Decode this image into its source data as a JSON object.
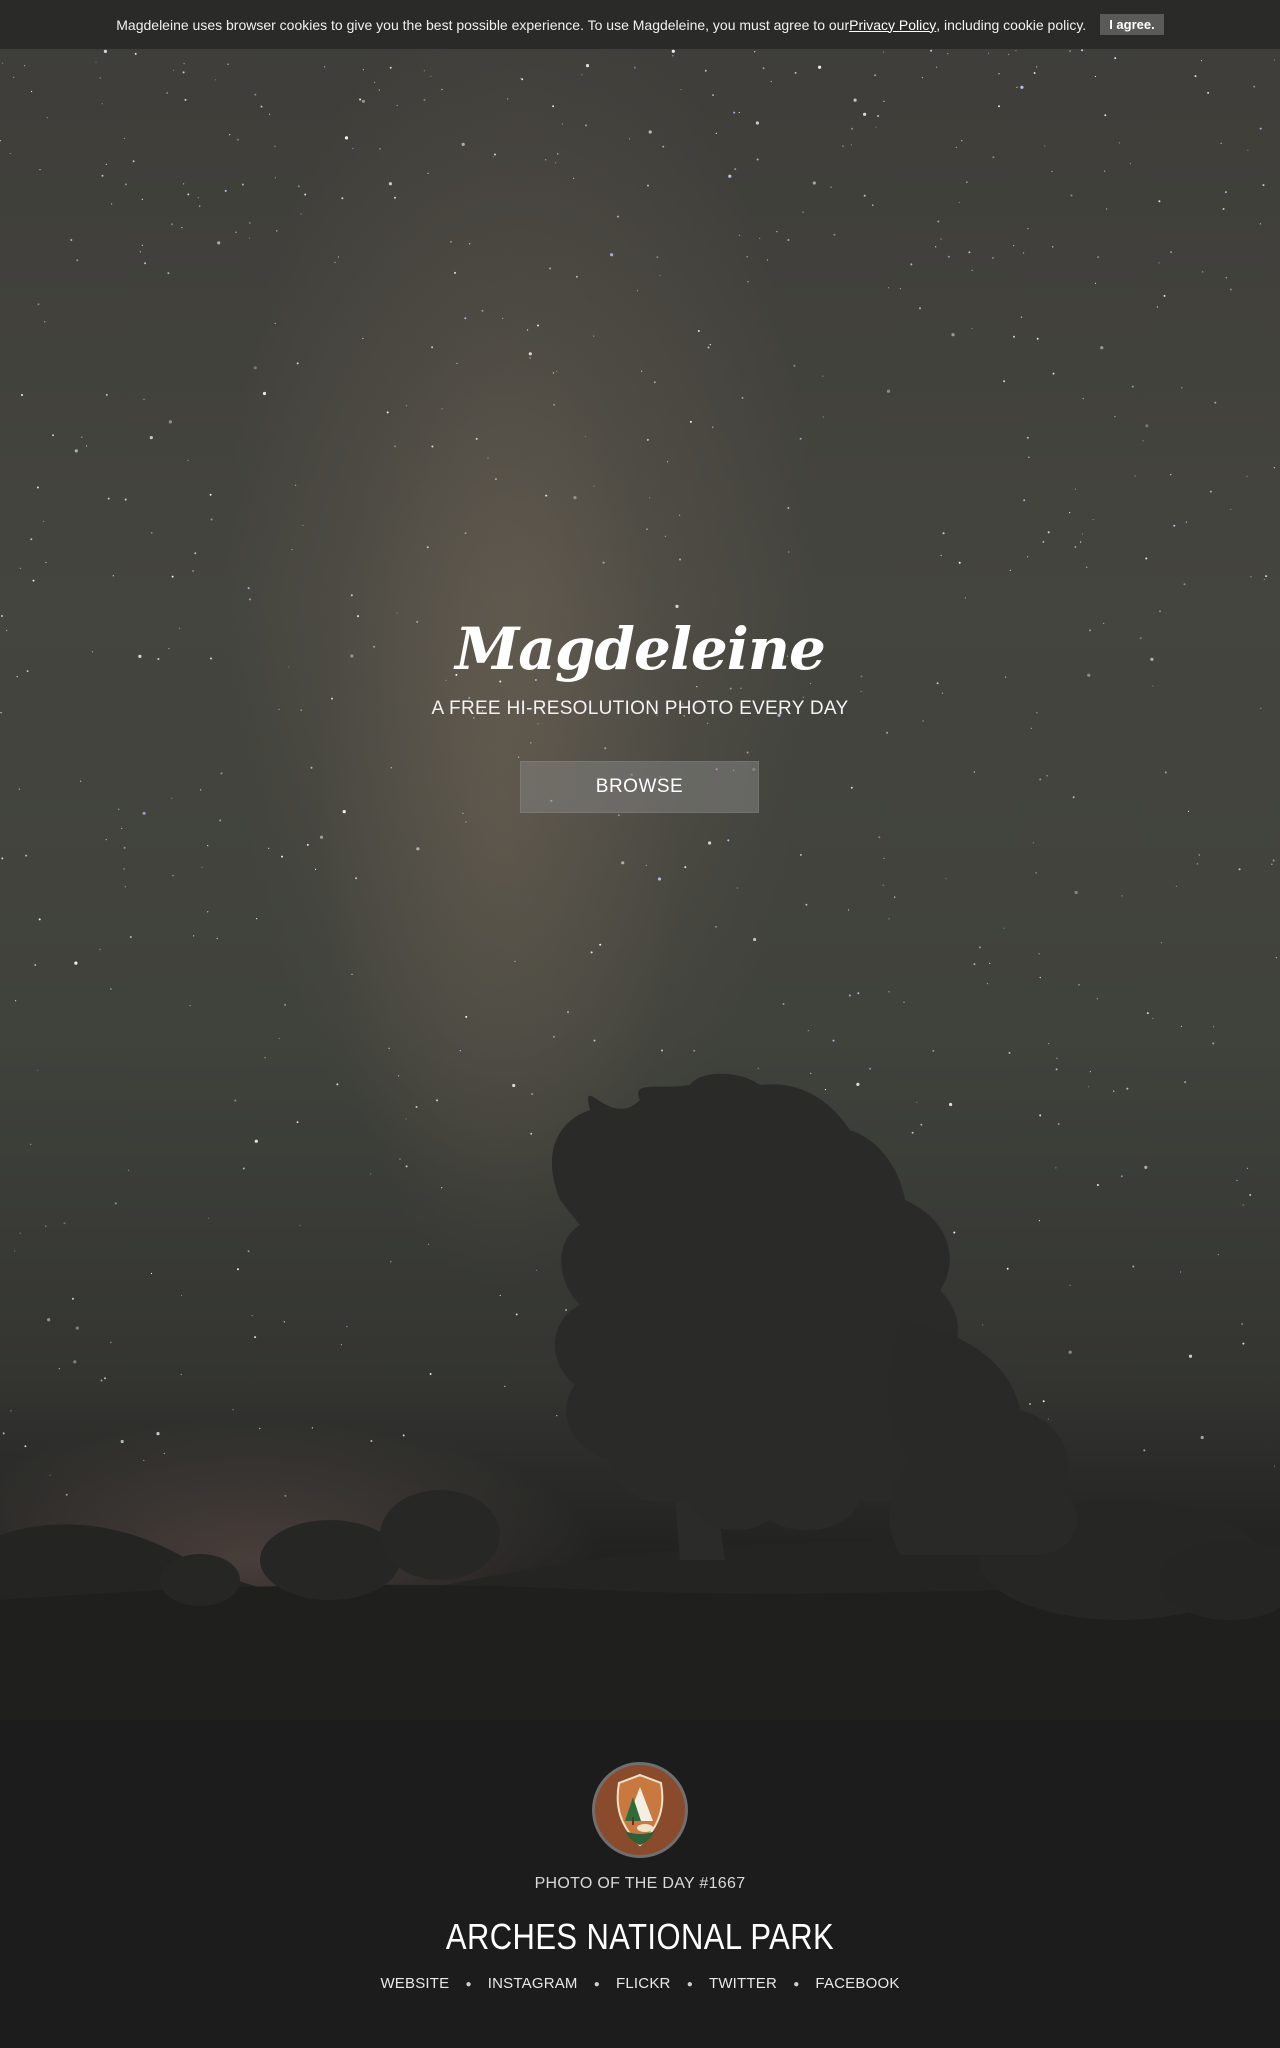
{
  "cookie_bar": {
    "text_before": "Magdeleine uses browser cookies to give you the best possible experience. To use Magdeleine, you must agree to our ",
    "policy_link": "Privacy Policy",
    "text_after": ", including cookie policy.",
    "agree_label": "I agree."
  },
  "hero": {
    "brand": "Magdeleine",
    "tagline": "A FREE HI-RESOLUTION PHOTO EVERY DAY",
    "browse_label": "BROWSE"
  },
  "photo": {
    "badge_icon": "national-park-service-arrowhead-icon",
    "photo_of_day": "PHOTO OF THE DAY #1667",
    "author": "ARCHES NATIONAL PARK",
    "links": [
      "WEBSITE",
      "INSTAGRAM",
      "FLICKR",
      "TWITTER",
      "FACEBOOK"
    ]
  },
  "colors": {
    "background": "#1b1c1b",
    "cookie_bar": "#2a2a29",
    "agree_button": "#5a5a58",
    "badge_fill": "#8a4a2c"
  }
}
